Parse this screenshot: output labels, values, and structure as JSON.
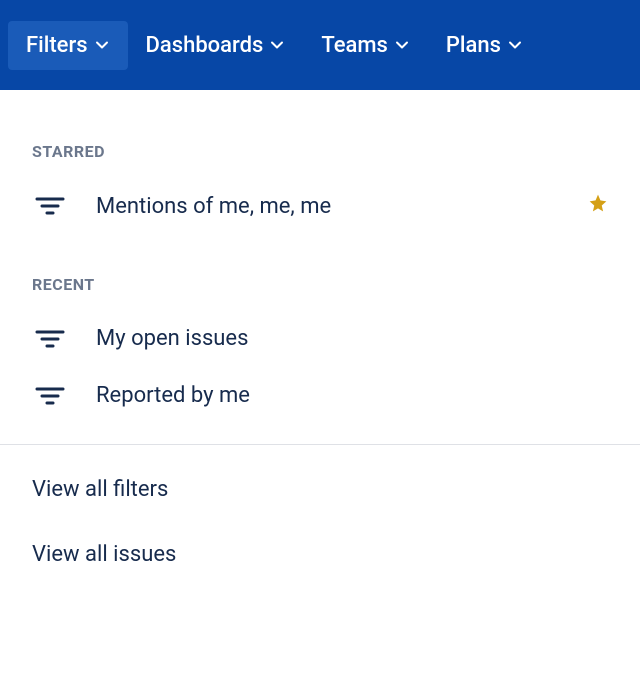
{
  "navbar": {
    "items": [
      {
        "label": "Filters",
        "active": true
      },
      {
        "label": "Dashboards",
        "active": false
      },
      {
        "label": "Teams",
        "active": false
      },
      {
        "label": "Plans",
        "active": false
      }
    ]
  },
  "dropdown": {
    "sections": [
      {
        "header": "STARRED",
        "items": [
          {
            "label": "Mentions of me, me, me",
            "starred": true
          }
        ]
      },
      {
        "header": "RECENT",
        "items": [
          {
            "label": "My open issues",
            "starred": false
          },
          {
            "label": "Reported by me",
            "starred": false
          }
        ]
      }
    ],
    "links": [
      {
        "label": "View all filters"
      },
      {
        "label": "View all issues"
      }
    ]
  }
}
